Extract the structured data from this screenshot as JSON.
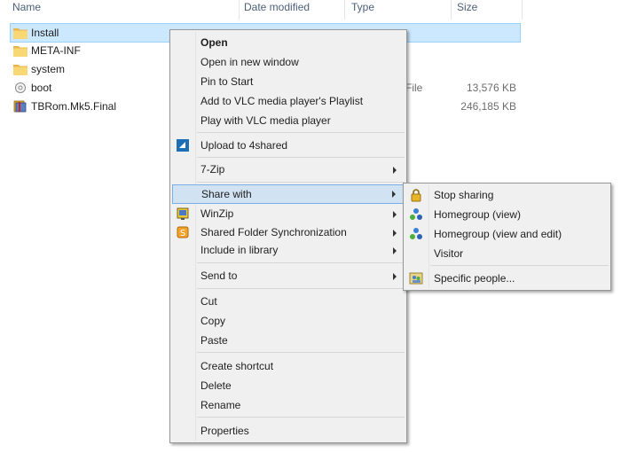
{
  "columns": {
    "name": "Name",
    "date_modified": "Date modified",
    "type": "Type",
    "size": "Size"
  },
  "files": [
    {
      "name": "Install",
      "icon": "folder-icon",
      "date": "",
      "type": "",
      "size": ""
    },
    {
      "name": "META-INF",
      "icon": "folder-icon",
      "date": "",
      "type": "",
      "size": ""
    },
    {
      "name": "system",
      "icon": "folder-icon",
      "date": "",
      "type": "",
      "size": ""
    },
    {
      "name": "boot",
      "icon": "file-icon",
      "date": "",
      "type": "File",
      "size": "13,576 KB"
    },
    {
      "name": "TBRom.Mk5.Final",
      "icon": "archive-icon",
      "date": "",
      "type": "",
      "size": "246,185 KB"
    }
  ],
  "context_menu": {
    "open": "Open",
    "open_new_window": "Open in new window",
    "pin_to_start": "Pin to Start",
    "add_vlc_playlist": "Add to VLC media player's Playlist",
    "play_vlc": "Play with VLC media player",
    "upload_4shared": "Upload to 4shared",
    "seven_zip": "7-Zip",
    "share_with": "Share with",
    "winzip": "WinZip",
    "shared_folder_sync": "Shared Folder Synchronization",
    "include_in_library": "Include in library",
    "send_to": "Send to",
    "cut": "Cut",
    "copy": "Copy",
    "paste": "Paste",
    "create_shortcut": "Create shortcut",
    "delete": "Delete",
    "rename": "Rename",
    "properties": "Properties"
  },
  "share_submenu": {
    "stop_sharing": "Stop sharing",
    "homegroup_view": "Homegroup (view)",
    "homegroup_view_edit": "Homegroup (view and edit)",
    "visitor": "Visitor",
    "specific_people": "Specific people..."
  },
  "colors": {
    "selection_bg": "#cce8ff",
    "menu_bg": "#f0f0f0",
    "menu_hover": "#d1e2f2",
    "header_text": "#4c607a"
  }
}
